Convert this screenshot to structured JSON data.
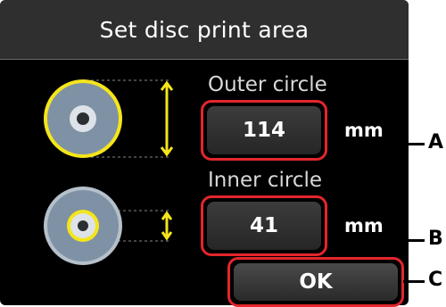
{
  "screen": {
    "title": "Set disc print area"
  },
  "outer": {
    "label": "Outer circle",
    "value": "114",
    "unit": "mm",
    "icon": "disc-outer-circle-icon"
  },
  "inner": {
    "label": "Inner circle",
    "value": "41",
    "unit": "mm",
    "icon": "disc-inner-circle-icon"
  },
  "ok_label": "OK",
  "callouts": {
    "a": "A",
    "b": "B",
    "c": "C"
  },
  "colors": {
    "highlight": "#e3262c",
    "guide": "#f5e51b"
  }
}
